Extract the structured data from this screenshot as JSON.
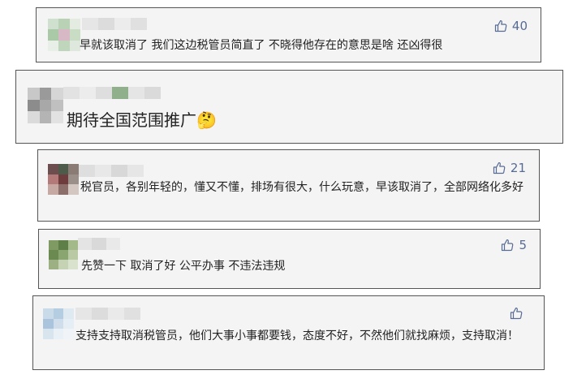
{
  "comments": [
    {
      "text": "早就该取消了 我们这边税管员简直了 不晓得他存在的意思是啥 还凶得很",
      "likes": "40"
    },
    {
      "text": "期待全国范围推广",
      "emoji": "🤔",
      "likes": ""
    },
    {
      "text": "税官员，各别年轻的，懂又不懂，排场有很大，什么玩意，早该取消了，全部网络化多好",
      "likes": "21"
    },
    {
      "text": "先赞一下 取消了好 公平办事 不违法违规",
      "likes": "5"
    },
    {
      "text": "支持支持取消税管员，他们大事小事都要钱，态度不好，不然他们就找麻烦，支持取消！",
      "likes": ""
    }
  ],
  "colors": {
    "like": "#576b95",
    "card_bg": "#f4f4f4",
    "card_border": "#555555"
  }
}
